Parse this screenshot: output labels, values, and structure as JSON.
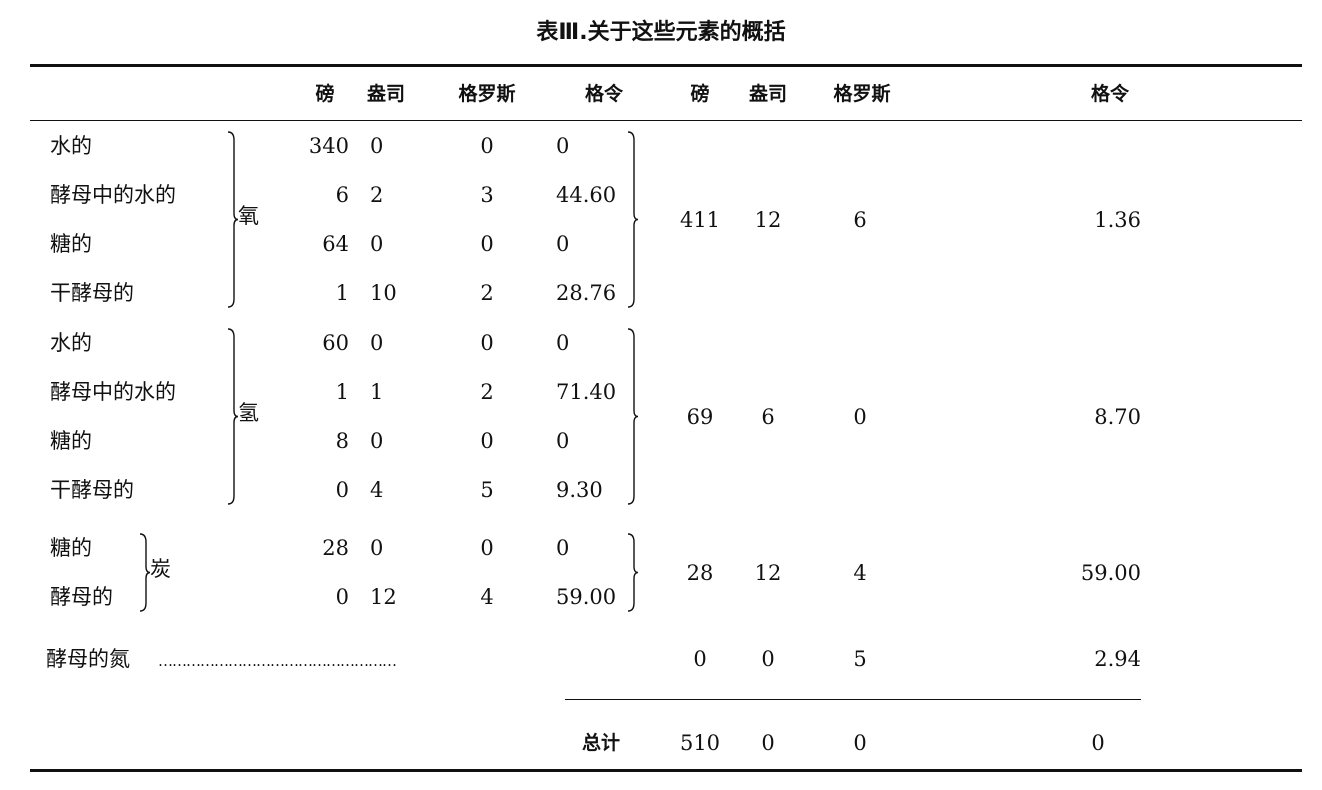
{
  "title": "表Ⅲ.关于这些元素的概括",
  "headers": [
    "磅",
    "盎司",
    "格罗斯",
    "格令",
    "磅",
    "盎司",
    "格罗斯",
    "格令"
  ],
  "groups": [
    {
      "element": "氧",
      "rows": [
        {
          "label": "水的",
          "values": [
            "340",
            "0",
            "0",
            "0"
          ]
        },
        {
          "label": "酵母中的水的",
          "values": [
            "6",
            "2",
            "3",
            "44.60"
          ]
        },
        {
          "label": "糖的",
          "values": [
            "64",
            "0",
            "0",
            "0"
          ]
        },
        {
          "label": "干酵母的",
          "values": [
            "1",
            "10",
            "2",
            "28.76"
          ]
        }
      ],
      "total": [
        "411",
        "12",
        "6",
        "1.36"
      ]
    },
    {
      "element": "氢",
      "rows": [
        {
          "label": "水的",
          "values": [
            "60",
            "0",
            "0",
            "0"
          ]
        },
        {
          "label": "酵母中的水的",
          "values": [
            "1",
            "1",
            "2",
            "71.40"
          ]
        },
        {
          "label": "糖的",
          "values": [
            "8",
            "0",
            "0",
            "0"
          ]
        },
        {
          "label": "干酵母的",
          "values": [
            "0",
            "4",
            "5",
            "9.30"
          ]
        }
      ],
      "total": [
        "69",
        "6",
        "0",
        "8.70"
      ]
    },
    {
      "element": "炭",
      "rows": [
        {
          "label": "糖的",
          "values": [
            "28",
            "0",
            "0",
            "0"
          ]
        },
        {
          "label": "酵母的",
          "values": [
            "0",
            "12",
            "4",
            "59.00"
          ]
        }
      ],
      "total": [
        "28",
        "12",
        "4",
        "59.00"
      ]
    }
  ],
  "nitrogen": {
    "label": "酵母的氮",
    "leader": "……………………………………………",
    "values": [
      "0",
      "0",
      "5",
      "2.94"
    ]
  },
  "grand_total": {
    "label": "总计",
    "values": [
      "510",
      "0",
      "0",
      "0"
    ]
  }
}
